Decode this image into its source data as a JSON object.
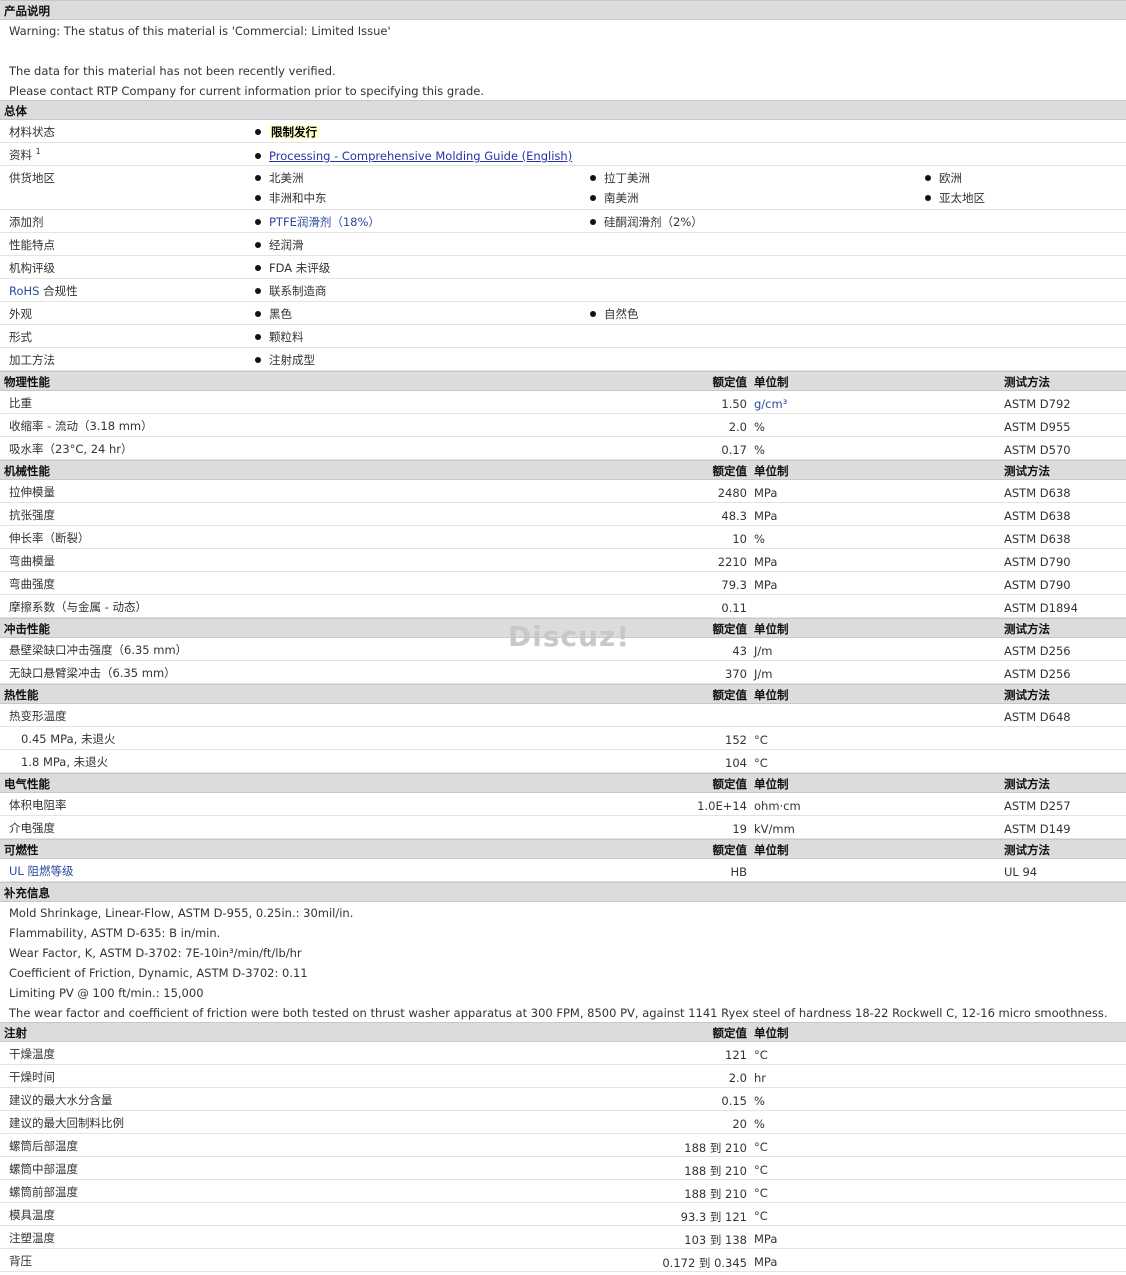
{
  "desc": {
    "title": "产品说明",
    "lines": [
      "Warning: The status of this material is 'Commercial: Limited Issue'",
      "",
      "The data for this material has not been recently verified.",
      "Please contact RTP Company for current information prior to specifying this grade."
    ]
  },
  "general": {
    "title": "总体",
    "status_label": "材料状态",
    "status_value": "限制发行",
    "docs_label": "资料",
    "docs_sup": "1",
    "docs_link": "Processing - Comprehensive Molding Guide (English)",
    "region_label": "供货地区",
    "regions": [
      "北美洲",
      "拉丁美洲",
      "欧洲",
      "非洲和中东",
      "南美洲",
      "亚太地区"
    ],
    "additive_label": "添加剂",
    "additives": [
      "PTFE润滑剂（18%）",
      "硅酮润滑剂（2%）"
    ],
    "feature_label": "性能特点",
    "feature_value": "经润滑",
    "agency_label": "机构评级",
    "agency_value": "FDA 未评级",
    "rohs_label_a": "RoHS",
    "rohs_label_b": " 合规性",
    "rohs_value": "联系制造商",
    "appearance_label": "外观",
    "appearances": [
      "黑色",
      "自然色"
    ],
    "form_label": "形式",
    "form_value": "颗粒料",
    "method_label": "加工方法",
    "method_value": "注射成型"
  },
  "headers": {
    "nominal": "额定值",
    "unit": "单位制",
    "method": "测试方法"
  },
  "physical": {
    "title": "物理性能",
    "rows": [
      {
        "label": "比重",
        "value": "1.50",
        "unit": "g/cm³",
        "method": "ASTM D792"
      },
      {
        "label": "收缩率 - 流动（3.18 mm）",
        "value": "2.0",
        "unit": "%",
        "method": "ASTM D955"
      },
      {
        "label": "吸水率（23°C, 24 hr）",
        "value": "0.17",
        "unit": "%",
        "method": "ASTM D570"
      }
    ]
  },
  "mechanical": {
    "title": "机械性能",
    "rows": [
      {
        "label": "拉伸模量",
        "value": "2480",
        "unit": "MPa",
        "method": "ASTM D638"
      },
      {
        "label": "抗张强度",
        "value": "48.3",
        "unit": "MPa",
        "method": "ASTM D638"
      },
      {
        "label": "伸长率（断裂）",
        "value": "10",
        "unit": "%",
        "method": "ASTM D638"
      },
      {
        "label": "弯曲模量",
        "value": "2210",
        "unit": "MPa",
        "method": "ASTM D790"
      },
      {
        "label": "弯曲强度",
        "value": "79.3",
        "unit": "MPa",
        "method": "ASTM D790"
      },
      {
        "label": "摩擦系数（与金属 - 动态）",
        "value": "0.11",
        "unit": "",
        "method": "ASTM D1894"
      }
    ]
  },
  "impact": {
    "title": "冲击性能",
    "rows": [
      {
        "label": "悬壁梁缺口冲击强度（6.35 mm）",
        "value": "43",
        "unit": "J/m",
        "method": "ASTM D256"
      },
      {
        "label": "无缺口悬臂梁冲击（6.35 mm）",
        "value": "370",
        "unit": "J/m",
        "method": "ASTM D256"
      }
    ]
  },
  "thermal": {
    "title": "热性能",
    "hdt_label": "热变形温度",
    "hdt_method": "ASTM D648",
    "rows": [
      {
        "label": "0.45 MPa, 未退火",
        "value": "152",
        "unit": "°C",
        "method": ""
      },
      {
        "label": "1.8 MPa, 未退火",
        "value": "104",
        "unit": "°C",
        "method": ""
      }
    ]
  },
  "electrical": {
    "title": "电气性能",
    "rows": [
      {
        "label": "体积电阻率",
        "value": "1.0E+14",
        "unit": "ohm·cm",
        "method": "ASTM D257"
      },
      {
        "label": "介电强度",
        "value": "19",
        "unit": "kV/mm",
        "method": "ASTM D149"
      }
    ]
  },
  "flammability": {
    "title": "可燃性",
    "rows": [
      {
        "label": "UL 阻燃等级",
        "value": "HB",
        "unit": "",
        "method": "UL 94"
      }
    ]
  },
  "supplement": {
    "title": "补充信息",
    "lines": [
      "Mold Shrinkage, Linear-Flow, ASTM D-955, 0.25in.: 30mil/in.",
      "Flammability, ASTM D-635: B in/min.",
      "Wear Factor, K, ASTM D-3702: 7E-10in³/min/ft/lb/hr",
      "Coefficient of Friction, Dynamic, ASTM D-3702: 0.11",
      "Limiting PV @ 100 ft/min.: 15,000",
      "The wear factor and coefficient of friction were both tested on thrust washer apparatus at 300 FPM, 8500 PV, against 1141 Ryex steel of hardness 18-22 Rockwell C, 12-16 micro smoothness."
    ]
  },
  "injection": {
    "title": "注射",
    "rows": [
      {
        "label": "干燥温度",
        "value": "121",
        "unit": "°C"
      },
      {
        "label": "干燥时间",
        "value": "2.0",
        "unit": "hr"
      },
      {
        "label": "建议的最大水分含量",
        "value": "0.15",
        "unit": "%"
      },
      {
        "label": "建议的最大回制料比例",
        "value": "20",
        "unit": "%"
      },
      {
        "label": "螺筒后部温度",
        "value": "188 到  210",
        "unit": "°C"
      },
      {
        "label": "螺筒中部温度",
        "value": "188 到  210",
        "unit": "°C"
      },
      {
        "label": "螺筒前部温度",
        "value": "188 到  210",
        "unit": "°C"
      },
      {
        "label": "模具温度",
        "value": "93.3 到  121",
        "unit": "°C"
      },
      {
        "label": "注塑温度",
        "value": "103 到  138",
        "unit": "MPa"
      },
      {
        "label": "背压",
        "value": "0.172 到  0.345",
        "unit": "MPa"
      }
    ]
  },
  "watermark": "Discuz!"
}
